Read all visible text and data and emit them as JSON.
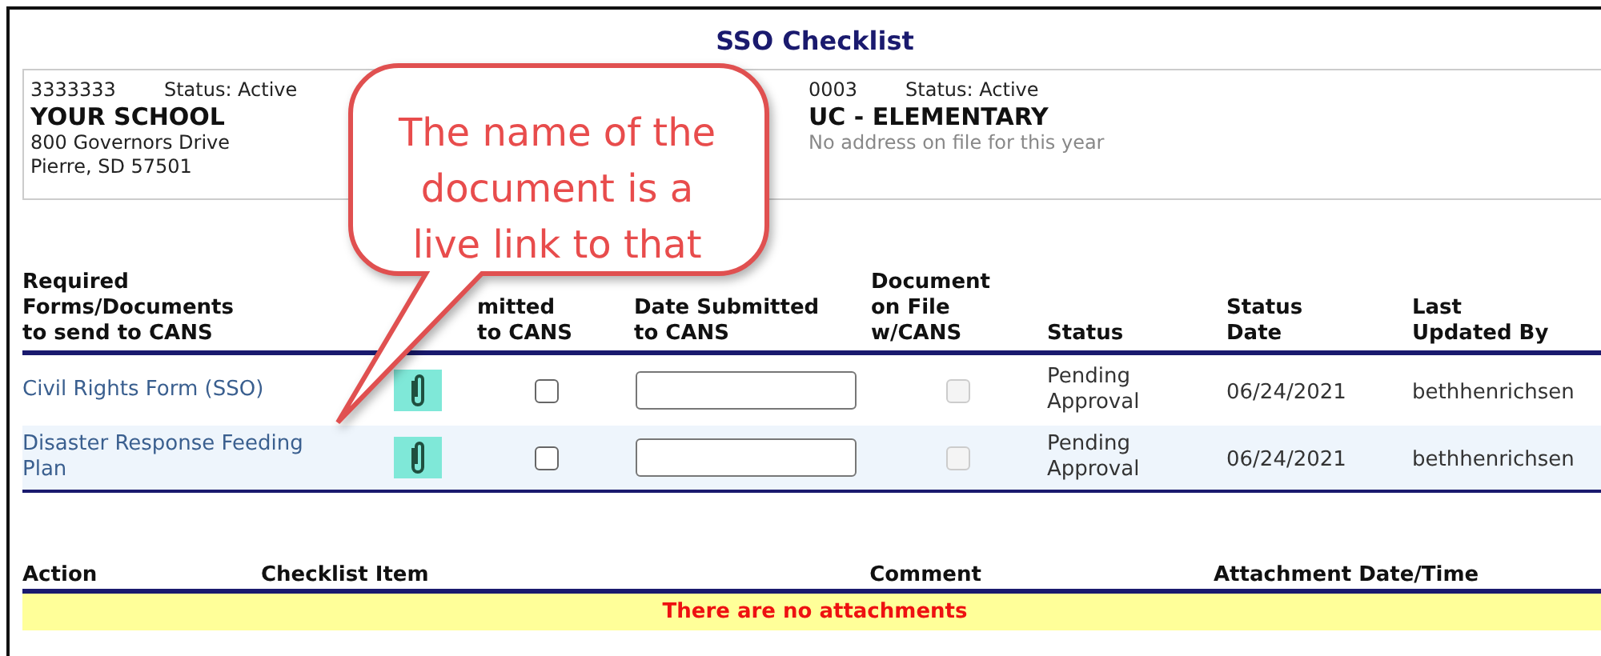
{
  "title": "SSO Checklist",
  "entities": [
    {
      "kind": "address",
      "code": "3333333",
      "status": "Status: Active",
      "name": "YOUR SCHOOL",
      "lines": [
        "800 Governors Drive",
        "Pierre, SD 57501"
      ]
    },
    {
      "kind": "note",
      "code": "0003",
      "status": "Status: Active",
      "name": "UC - ELEMENTARY",
      "lines": [
        "No address on file for this year"
      ]
    }
  ],
  "documents": {
    "columns": [
      {
        "lines": [
          "Required",
          "Forms/Documents",
          "to send to CANS"
        ]
      },
      {},
      {
        "lines": [
          "mitted",
          "to CANS"
        ]
      },
      {
        "lines": [
          "Date Submitted",
          "to CANS"
        ]
      },
      {
        "lines": [
          "Document",
          "on File",
          "w/CANS"
        ]
      },
      {
        "lines": [
          "Status"
        ]
      },
      {
        "lines": [
          "Status",
          "Date"
        ]
      },
      {
        "lines": [
          "Last",
          "Updated By"
        ]
      }
    ],
    "rows": [
      {
        "name": "Civil Rights Form (SSO)",
        "has_attachment": true,
        "submitted": false,
        "on_file": false,
        "on_file_disabled": true,
        "status": "Pending Approval",
        "status_date": "06/24/2021",
        "updated_by": "bethhenrichsen"
      },
      {
        "name": "Disaster Response Feeding Plan",
        "has_attachment": true,
        "submitted": false,
        "on_file": false,
        "on_file_disabled": true,
        "status": "Pending Approval",
        "status_date": "06/24/2021",
        "updated_by": "bethhenrichsen"
      }
    ]
  },
  "attachments": {
    "columns": [
      "Action",
      "Checklist Item",
      "Comment",
      "Attachment Date/Time"
    ],
    "empty_message": "There are no attachments"
  },
  "callout": {
    "text": "The name of the document is a live link to that"
  }
}
